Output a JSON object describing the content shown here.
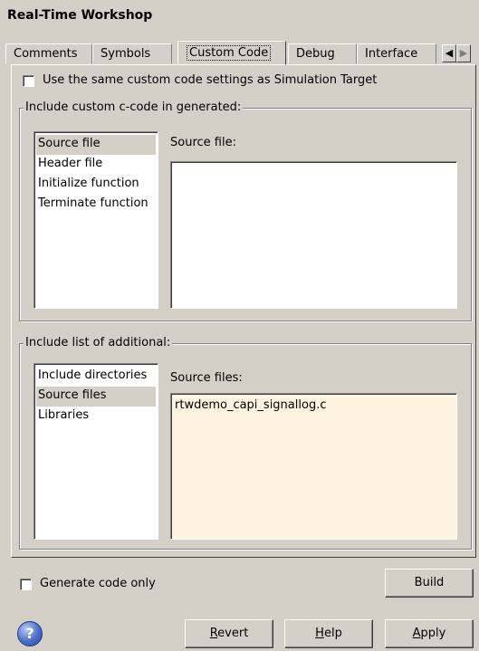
{
  "window": {
    "title": "Real-Time Workshop"
  },
  "tabs": [
    {
      "label": "Comments"
    },
    {
      "label": "Symbols"
    },
    {
      "label": "Custom Code"
    },
    {
      "label": "Debug"
    },
    {
      "label": "Interface"
    }
  ],
  "tab_nav": {
    "left": "◀",
    "right": "▶"
  },
  "same_settings": {
    "label": "Use the same custom code settings as Simulation Target",
    "checked": false
  },
  "include_code_group": {
    "legend": "Include custom c-code in generated:",
    "items": [
      "Source file",
      "Header file",
      "Initialize function",
      "Terminate function"
    ],
    "selected_index": 0,
    "editor_label": "Source file:",
    "editor_value": ""
  },
  "include_list_group": {
    "legend": "Include list of additional:",
    "items": [
      "Include directories",
      "Source files",
      "Libraries"
    ],
    "selected_index": 1,
    "editor_label": "Source files:",
    "editor_value": "rtwdemo_capi_signallog.c",
    "editor_bg": "#fdf3df"
  },
  "generate_only": {
    "label": "Generate code only",
    "checked": false
  },
  "buttons": {
    "build": "Build",
    "revert_u": "R",
    "revert_rest": "evert",
    "help_u": "H",
    "help_rest": "elp",
    "apply_u": "A",
    "apply_rest": "pply"
  },
  "help_icon": {
    "glyph": "?"
  }
}
